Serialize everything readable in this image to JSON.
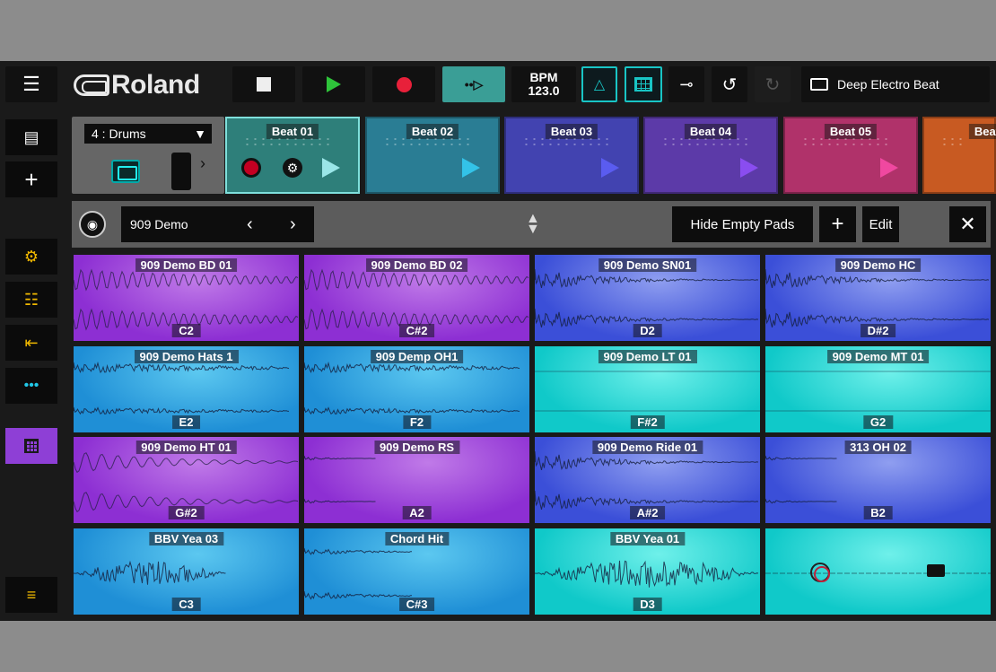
{
  "toolbar": {
    "logo_text": "Roland",
    "bpm_label": "BPM",
    "bpm_value": "123.0",
    "project_name": "Deep Electro Beat"
  },
  "sidebar": {
    "items": [
      {
        "name": "sidebar-item-browser",
        "icon": "list-icon"
      },
      {
        "name": "sidebar-item-add",
        "icon": "plus-icon"
      },
      {
        "name": "sidebar-item-mixer",
        "icon": "sliders-icon"
      },
      {
        "name": "sidebar-item-effects",
        "icon": "plug-icon"
      },
      {
        "name": "sidebar-item-import",
        "icon": "import-icon"
      },
      {
        "name": "sidebar-item-sampler",
        "icon": "wave-icon"
      },
      {
        "name": "sidebar-item-pads",
        "icon": "grid-icon"
      },
      {
        "name": "sidebar-item-master",
        "icon": "faders-icon"
      }
    ]
  },
  "track": {
    "selected": "4 : Drums"
  },
  "beats": [
    {
      "label": "Beat 01",
      "color": "#2e7f7a",
      "play": "#9ae6e8"
    },
    {
      "label": "Beat 02",
      "color": "#2a7d94",
      "play": "#33c3e8"
    },
    {
      "label": "Beat 03",
      "color": "#4243b0",
      "play": "#5a5cf0"
    },
    {
      "label": "Beat 04",
      "color": "#5c3aa8",
      "play": "#8a4df0"
    },
    {
      "label": "Beat 05",
      "color": "#b0326a",
      "play": "#f048a0"
    },
    {
      "label": "Beat",
      "color": "#c85a22",
      "play": "#f07030"
    }
  ],
  "kit": {
    "name": "909 Demo",
    "hide_empty_label": "Hide Empty Pads",
    "edit_label": "Edit"
  },
  "pads": [
    {
      "name": "909 Demo BD 01",
      "note": "C2",
      "color": "purple",
      "wave": "bd"
    },
    {
      "name": "909 Demo BD 02",
      "note": "C#2",
      "color": "purple",
      "wave": "bd"
    },
    {
      "name": "909 Demo SN01",
      "note": "D2",
      "color": "indigo",
      "wave": "sn"
    },
    {
      "name": "909 Demo HC",
      "note": "D#2",
      "color": "indigo",
      "wave": "sn"
    },
    {
      "name": "909 Demo Hats 1",
      "note": "E2",
      "color": "blue",
      "wave": "hat"
    },
    {
      "name": "909 Demp OH1",
      "note": "F2",
      "color": "blue",
      "wave": "hat"
    },
    {
      "name": "909 Demo LT 01",
      "note": "F#2",
      "color": "cyan",
      "wave": "flat"
    },
    {
      "name": "909 Demo MT 01",
      "note": "G2",
      "color": "cyan",
      "wave": "flat"
    },
    {
      "name": "909 Demo HT 01",
      "note": "G#2",
      "color": "purple",
      "wave": "tom"
    },
    {
      "name": "909 Demo RS",
      "note": "A2",
      "color": "purple",
      "wave": "rs"
    },
    {
      "name": "909 Demo Ride 01",
      "note": "A#2",
      "color": "indigo",
      "wave": "sn"
    },
    {
      "name": "313 OH 02",
      "note": "B2",
      "color": "indigo",
      "wave": "rs"
    },
    {
      "name": "BBV Yea 03",
      "note": "C3",
      "color": "blue",
      "wave": "vox"
    },
    {
      "name": "Chord Hit",
      "note": "C#3",
      "color": "blue",
      "wave": "chord"
    },
    {
      "name": "BBV Yea 01",
      "note": "D3",
      "color": "cyan",
      "wave": "vox2"
    },
    {
      "name": "",
      "note": "",
      "color": "cyan",
      "wave": "empty"
    }
  ],
  "colors": {
    "purple": [
      "#8d2fd3",
      "#c07ae8"
    ],
    "indigo": [
      "#3b4fd8",
      "#8f9ef0"
    ],
    "blue": [
      "#1f8fd6",
      "#5cc8f0"
    ],
    "cyan": [
      "#10c9c9",
      "#6ff0ea"
    ]
  }
}
